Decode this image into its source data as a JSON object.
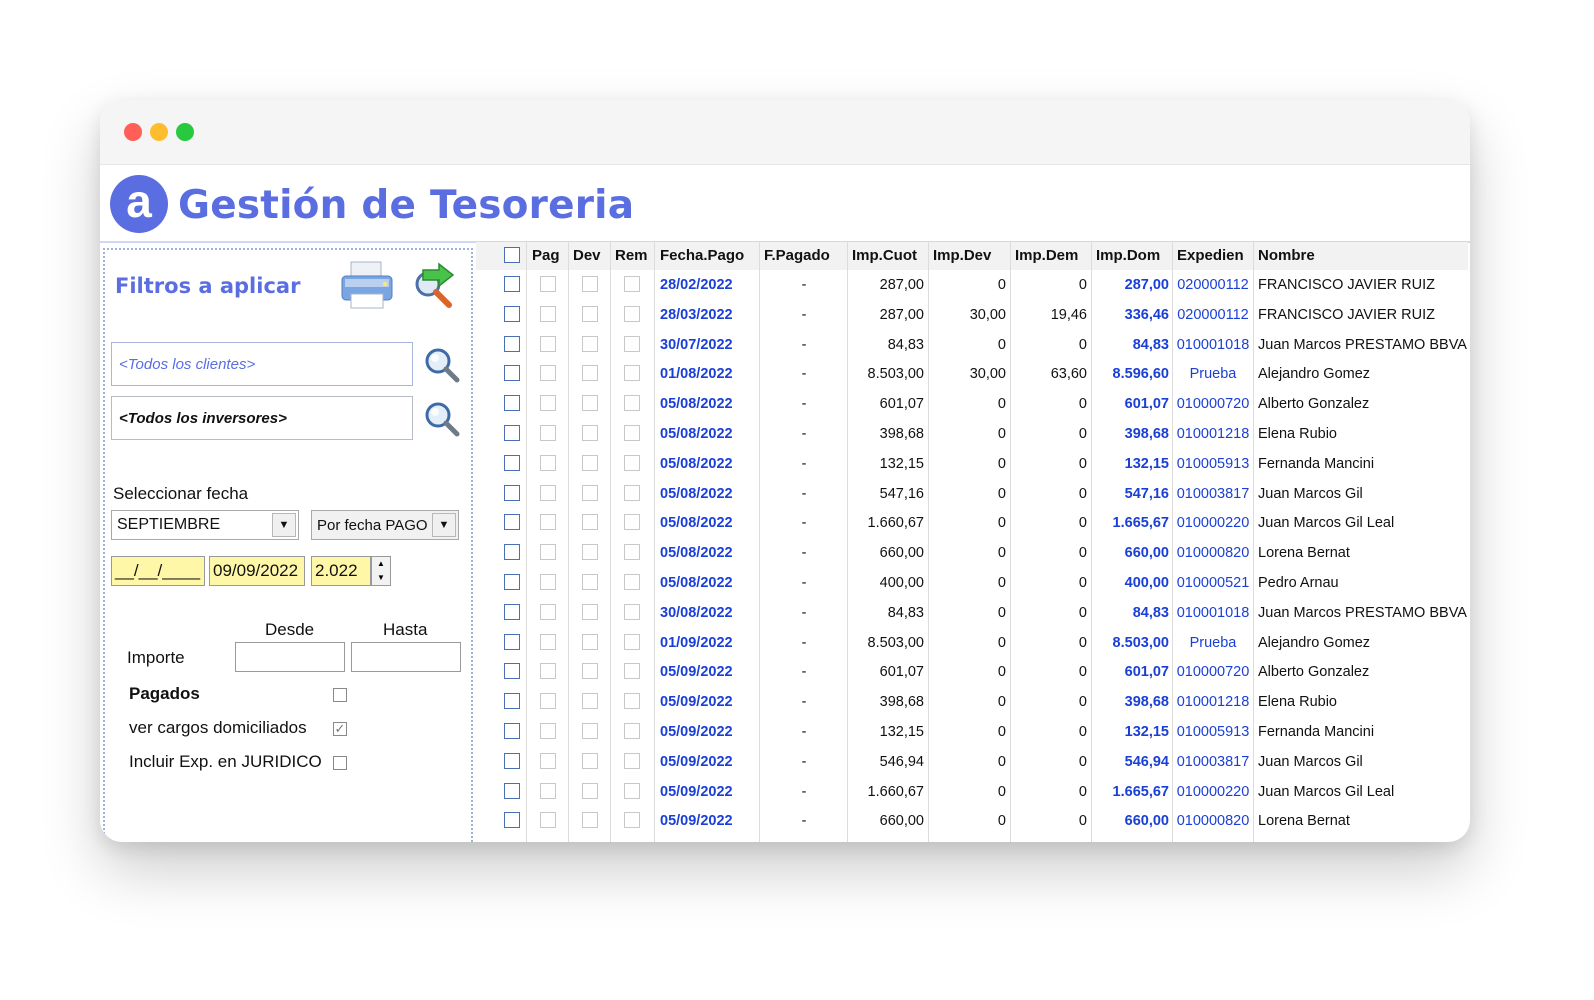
{
  "app": {
    "title": "Gestión de Tesoreria",
    "logo_letter": "a"
  },
  "filters": {
    "title": "Filtros a aplicar",
    "clients_placeholder": "<Todos los clientes>",
    "investors_placeholder": "<Todos los inversores>",
    "select_date_label": "Seleccionar fecha",
    "month_selected": "SEPTIEMBRE",
    "date_mode_selected": "Por fecha PAGO",
    "date_from": "__/__/____",
    "date_to": "09/09/2022",
    "year": "2.022",
    "from_label": "Desde",
    "to_label": "Hasta",
    "importe_label": "Importe",
    "pagados_label": "Pagados",
    "cargos_label": "ver cargos domiciliados",
    "juridico_label": "Incluir Exp. en JURIDICO"
  },
  "table": {
    "headers": [
      "Pag",
      "Dev",
      "Rem",
      "Fecha.Pago",
      "F.Pagado",
      "Imp.Cuot",
      "Imp.Dev",
      "Imp.Dem",
      "Imp.Dom",
      "Expedien",
      "Nombre"
    ],
    "rows": [
      {
        "fecha": "28/02/2022",
        "fpagado": "-",
        "cuot": "287,00",
        "dev": "0",
        "dem": "0",
        "dom": "287,00",
        "exp": "020000112",
        "nombre": "FRANCISCO JAVIER RUIZ"
      },
      {
        "fecha": "28/03/2022",
        "fpagado": "-",
        "cuot": "287,00",
        "dev": "30,00",
        "dem": "19,46",
        "dom": "336,46",
        "exp": "020000112",
        "nombre": "FRANCISCO JAVIER RUIZ"
      },
      {
        "fecha": "30/07/2022",
        "fpagado": "-",
        "cuot": "84,83",
        "dev": "0",
        "dem": "0",
        "dom": "84,83",
        "exp": "010001018",
        "nombre": "Juan Marcos PRESTAMO BBVA"
      },
      {
        "fecha": "01/08/2022",
        "fpagado": "-",
        "cuot": "8.503,00",
        "dev": "30,00",
        "dem": "63,60",
        "dom": "8.596,60",
        "exp": "Prueba",
        "nombre": "Alejandro Gomez"
      },
      {
        "fecha": "05/08/2022",
        "fpagado": "-",
        "cuot": "601,07",
        "dev": "0",
        "dem": "0",
        "dom": "601,07",
        "exp": "010000720",
        "nombre": "Alberto Gonzalez"
      },
      {
        "fecha": "05/08/2022",
        "fpagado": "-",
        "cuot": "398,68",
        "dev": "0",
        "dem": "0",
        "dom": "398,68",
        "exp": "010001218",
        "nombre": "Elena Rubio"
      },
      {
        "fecha": "05/08/2022",
        "fpagado": "-",
        "cuot": "132,15",
        "dev": "0",
        "dem": "0",
        "dom": "132,15",
        "exp": "010005913",
        "nombre": "Fernanda Mancini"
      },
      {
        "fecha": "05/08/2022",
        "fpagado": "-",
        "cuot": "547,16",
        "dev": "0",
        "dem": "0",
        "dom": "547,16",
        "exp": "010003817",
        "nombre": "Juan Marcos Gil"
      },
      {
        "fecha": "05/08/2022",
        "fpagado": "-",
        "cuot": "1.660,67",
        "dev": "0",
        "dem": "0",
        "dom": "1.665,67",
        "exp": "010000220",
        "nombre": "Juan Marcos Gil Leal"
      },
      {
        "fecha": "05/08/2022",
        "fpagado": "-",
        "cuot": "660,00",
        "dev": "0",
        "dem": "0",
        "dom": "660,00",
        "exp": "010000820",
        "nombre": "Lorena Bernat"
      },
      {
        "fecha": "05/08/2022",
        "fpagado": "-",
        "cuot": "400,00",
        "dev": "0",
        "dem": "0",
        "dom": "400,00",
        "exp": "010000521",
        "nombre": "Pedro Arnau"
      },
      {
        "fecha": "30/08/2022",
        "fpagado": "-",
        "cuot": "84,83",
        "dev": "0",
        "dem": "0",
        "dom": "84,83",
        "exp": "010001018",
        "nombre": "Juan Marcos PRESTAMO BBVA"
      },
      {
        "fecha": "01/09/2022",
        "fpagado": "-",
        "cuot": "8.503,00",
        "dev": "0",
        "dem": "0",
        "dom": "8.503,00",
        "exp": "Prueba",
        "nombre": "Alejandro Gomez"
      },
      {
        "fecha": "05/09/2022",
        "fpagado": "-",
        "cuot": "601,07",
        "dev": "0",
        "dem": "0",
        "dom": "601,07",
        "exp": "010000720",
        "nombre": "Alberto Gonzalez"
      },
      {
        "fecha": "05/09/2022",
        "fpagado": "-",
        "cuot": "398,68",
        "dev": "0",
        "dem": "0",
        "dom": "398,68",
        "exp": "010001218",
        "nombre": "Elena Rubio"
      },
      {
        "fecha": "05/09/2022",
        "fpagado": "-",
        "cuot": "132,15",
        "dev": "0",
        "dem": "0",
        "dom": "132,15",
        "exp": "010005913",
        "nombre": "Fernanda Mancini"
      },
      {
        "fecha": "05/09/2022",
        "fpagado": "-",
        "cuot": "546,94",
        "dev": "0",
        "dem": "0",
        "dom": "546,94",
        "exp": "010003817",
        "nombre": "Juan Marcos Gil"
      },
      {
        "fecha": "05/09/2022",
        "fpagado": "-",
        "cuot": "1.660,67",
        "dev": "0",
        "dem": "0",
        "dom": "1.665,67",
        "exp": "010000220",
        "nombre": "Juan Marcos Gil Leal"
      },
      {
        "fecha": "05/09/2022",
        "fpagado": "-",
        "cuot": "660,00",
        "dev": "0",
        "dem": "0",
        "dom": "660,00",
        "exp": "010000820",
        "nombre": "Lorena Bernat"
      }
    ]
  },
  "colors": {
    "accent": "#5b6ee1",
    "link": "#1a3fd6",
    "date_field": "#fff7a8"
  }
}
